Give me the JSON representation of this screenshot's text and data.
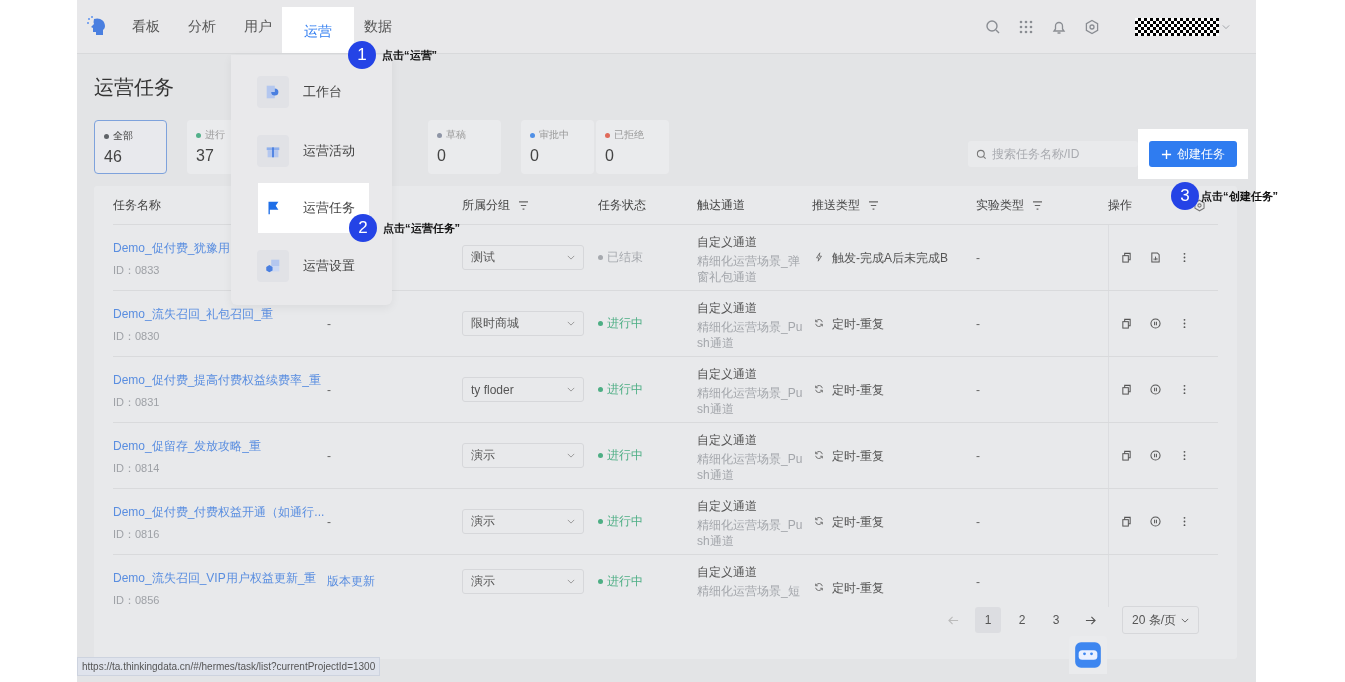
{
  "nav": {
    "items": [
      {
        "label": "看板",
        "selected": false
      },
      {
        "label": "分析",
        "selected": false
      },
      {
        "label": "用户",
        "selected": false
      },
      {
        "label": "运营",
        "selected": true
      },
      {
        "label": "数据",
        "selected": false
      }
    ]
  },
  "menu": {
    "items": [
      {
        "label": "工作台",
        "selected": false
      },
      {
        "label": "运营活动",
        "selected": false
      },
      {
        "label": "运营任务",
        "selected": true
      },
      {
        "label": "运营设置",
        "selected": false
      }
    ]
  },
  "page_title": "运营任务",
  "stats": [
    {
      "label": "全部",
      "count": "46",
      "color": "#5f6368",
      "selected": true
    },
    {
      "label": "进行",
      "count": "37",
      "color": "#52b08a",
      "selected": false
    },
    {
      "label": "草稿",
      "count": "0",
      "color": "#8e95a6",
      "selected": false
    },
    {
      "label": "审批中",
      "count": "0",
      "color": "#4f8fe6",
      "selected": false
    },
    {
      "label": "已拒绝",
      "count": "0",
      "color": "#e06a5a",
      "selected": false
    }
  ],
  "search": {
    "placeholder": "搜索任务名称/ID"
  },
  "create_button": "创建任务",
  "table": {
    "columns": [
      {
        "label": "任务名称",
        "filter": false
      },
      {
        "label": "所属分组",
        "filter": true
      },
      {
        "label": "任务状态",
        "filter": false
      },
      {
        "label": "触达通道",
        "filter": false
      },
      {
        "label": "推送类型",
        "filter": true
      },
      {
        "label": "实验类型",
        "filter": true
      },
      {
        "label": "操作",
        "filter": false
      }
    ],
    "rows": [
      {
        "name": "Demo_促付费_犹豫用",
        "id": "ID：0833",
        "group": "测试",
        "status": {
          "label": "已结束",
          "color": "#a6a9ae"
        },
        "channel": "自定义通道",
        "channel_detail": "精细化运营场景_弹窗礼包通道",
        "push": {
          "kind": "trigger",
          "label": "触发-完成A后未完成B"
        },
        "experiment": "-",
        "actions": [
          {
            "kind": "copy"
          },
          {
            "kind": "report"
          },
          {
            "kind": "more"
          }
        ]
      },
      {
        "name": "Demo_流失召回_礼包召回_重",
        "id": "ID：0830",
        "tag": "-",
        "group": "限时商城",
        "status": {
          "label": "进行中",
          "color": "#4dae84"
        },
        "channel": "自定义通道",
        "channel_detail": "精细化运营场景_Push通道",
        "push": {
          "kind": "repeat",
          "label": "定时-重复"
        },
        "experiment": "-",
        "actions": [
          {
            "kind": "copy"
          },
          {
            "kind": "pause"
          },
          {
            "kind": "more"
          }
        ]
      },
      {
        "name": "Demo_促付费_提高付费权益续费率_重",
        "id": "ID：0831",
        "tag": "-",
        "group": "ty floder",
        "status": {
          "label": "进行中",
          "color": "#4dae84"
        },
        "channel": "自定义通道",
        "channel_detail": "精细化运营场景_Push通道",
        "push": {
          "kind": "repeat",
          "label": "定时-重复"
        },
        "experiment": "-",
        "actions": [
          {
            "kind": "copy"
          },
          {
            "kind": "pause"
          },
          {
            "kind": "more"
          }
        ]
      },
      {
        "name": "Demo_促留存_发放攻略_重",
        "id": "ID：0814",
        "tag": "-",
        "group": "演示",
        "status": {
          "label": "进行中",
          "color": "#4dae84"
        },
        "channel": "自定义通道",
        "channel_detail": "精细化运营场景_Push通道",
        "push": {
          "kind": "repeat",
          "label": "定时-重复"
        },
        "experiment": "-",
        "actions": [
          {
            "kind": "copy"
          },
          {
            "kind": "pause"
          },
          {
            "kind": "more"
          }
        ]
      },
      {
        "name": "Demo_促付费_付费权益开通（如通行...",
        "id": "ID：0816",
        "tag": "-",
        "group": "演示",
        "status": {
          "label": "进行中",
          "color": "#4dae84"
        },
        "channel": "自定义通道",
        "channel_detail": "精细化运营场景_Push通道",
        "push": {
          "kind": "repeat",
          "label": "定时-重复"
        },
        "experiment": "-",
        "actions": [
          {
            "kind": "copy"
          },
          {
            "kind": "pause"
          },
          {
            "kind": "more"
          }
        ]
      },
      {
        "name": "Demo_流失召回_VIP用户权益更新_重",
        "id": "ID：0856",
        "tag": "版本更新",
        "group": "演示",
        "status": {
          "label": "进行中",
          "color": "#4dae84"
        },
        "channel": "自定义通道",
        "channel_detail": "精细化运营场景_短",
        "push": {
          "kind": "repeat",
          "label": "定时-重复"
        },
        "experiment": "-"
      }
    ]
  },
  "pagination": {
    "pages": [
      {
        "label": "1",
        "selected": true
      },
      {
        "label": "2",
        "selected": false
      },
      {
        "label": "3",
        "selected": false
      }
    ],
    "page_size": "20 条/页"
  },
  "annotations": [
    {
      "number": "1",
      "text": "点击“运营”"
    },
    {
      "number": "2",
      "text": "点击“运营任务”"
    },
    {
      "number": "3",
      "text": "点击“创建任务”"
    }
  ],
  "status_url": "https://ta.thinkingdata.cn/#/hermes/task/list?currentProjectId=1300"
}
